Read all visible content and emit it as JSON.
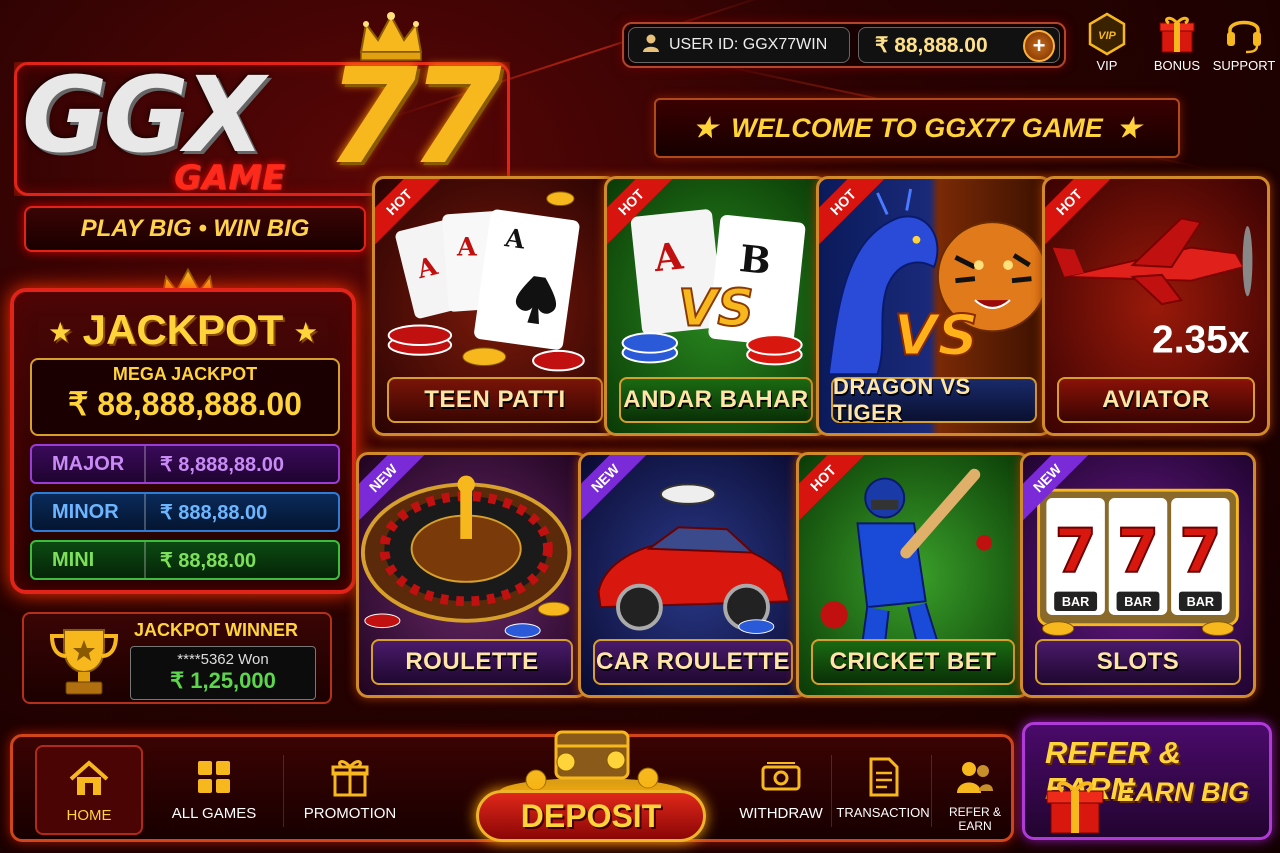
{
  "logo": {
    "brand_main": "GGX",
    "brand_num": "77",
    "brand_sub": "GAME",
    "tagline": "PLAY BIG • WIN BIG"
  },
  "header": {
    "user_id": "USER ID: GGX77WIN",
    "balance": "₹ 88,888.00",
    "add_funds": "+",
    "vip_label": "VIP",
    "bonus_label": "BONUS",
    "support_label": "SUPPORT",
    "vip_badge_text": "VIP"
  },
  "welcome": {
    "text": "WELCOME TO GGX77 GAME",
    "star": "★"
  },
  "jackpot": {
    "title": "JACKPOT",
    "star": "★",
    "mega_label": "MEGA JACKPOT",
    "mega_value": "₹ 88,888,888.00",
    "tiers": [
      {
        "label": "MAJOR",
        "value": "₹ 8,888,88.00"
      },
      {
        "label": "MINOR",
        "value": "₹ 888,88.00"
      },
      {
        "label": "MINI",
        "value": "₹ 88,88.00"
      }
    ]
  },
  "winner": {
    "title": "JACKPOT WINNER",
    "who": "****5362 Won",
    "amount": "₹ 1,25,000"
  },
  "games": [
    {
      "name": "TEEN PATTI",
      "badge": "HOT"
    },
    {
      "name": "ANDAR BAHAR",
      "badge": "HOT"
    },
    {
      "name": "DRAGON VS TIGER",
      "badge": "HOT"
    },
    {
      "name": "AVIATOR",
      "badge": "HOT",
      "multiplier": "2.35x"
    },
    {
      "name": "ROULETTE",
      "badge": "NEW"
    },
    {
      "name": "CAR ROULETTE",
      "badge": "NEW"
    },
    {
      "name": "CRICKET BET",
      "badge": "HOT"
    },
    {
      "name": "SLOTS",
      "badge": "NEW",
      "reel_label": "BAR"
    }
  ],
  "card_art_text": {
    "vs": "VS",
    "ace": "A",
    "b": "B",
    "seven": "7"
  },
  "nav": {
    "home": "HOME",
    "all_games": "ALL GAMES",
    "promotion": "PROMOTION",
    "deposit": "DEPOSIT",
    "withdraw": "WITHDRAW",
    "transaction": "TRANSACTION",
    "refer": "REFER & EARN"
  },
  "refer_banner": {
    "title": "REFER & EARN",
    "subtitle": "EARN BIG"
  },
  "colors": {
    "gold": "#ffd33a",
    "red_accent": "#e2231a",
    "bg_dark": "#180000"
  }
}
